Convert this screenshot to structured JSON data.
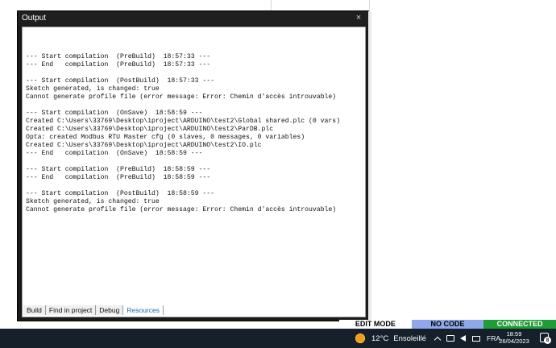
{
  "output_panel": {
    "title": "Output",
    "close_glyph": "×",
    "lines": [
      "",
      "--- Start compilation  (PreBuild)  18:57:33 ---",
      "--- End   compilation  (PreBuild)  18:57:33 ---",
      "",
      "--- Start compilation  (PostBuild)  18:57:33 ---",
      "Sketch generated, is changed: true",
      "Cannot generate profile file (error message: Error: Chemin d'accès introuvable)",
      "",
      "--- Start compilation  (OnSave)  18:58:59 ---",
      "Created C:\\Users\\33769\\Desktop\\1project\\ARDUINO\\test2\\Global shared.plc (0 vars)",
      "Created C:\\Users\\33769\\Desktop\\1project\\ARDUINO\\test2\\ParDB.plc",
      "Opta: created Modbus RTU Master cfg (0 slaves, 0 messages, 0 variables)",
      "Created C:\\Users\\33769\\Desktop\\1project\\ARDUINO\\test2\\IO.plc",
      "--- End   compilation  (OnSave)  18:58:59 ---",
      "",
      "--- Start compilation  (PreBuild)  18:58:59 ---",
      "--- End   compilation  (PreBuild)  18:58:59 ---",
      "",
      "--- Start compilation  (PostBuild)  18:58:59 ---",
      "Sketch generated, is changed: true",
      "Cannot generate profile file (error message: Error: Chemin d'accès introuvable)"
    ],
    "tabs": [
      {
        "label": "Build",
        "active": false
      },
      {
        "label": "Find in project",
        "active": false
      },
      {
        "label": "Debug",
        "active": false
      },
      {
        "label": "Resources",
        "active": true
      }
    ]
  },
  "status_modes": [
    {
      "label": "EDIT MODE",
      "bg": "#ffffff",
      "fg": "#000000"
    },
    {
      "label": "NO CODE",
      "bg": "#8ea8ea",
      "fg": "#000000"
    },
    {
      "label": "CONNECTED",
      "bg": "#1e9d36",
      "fg": "#ffffff"
    }
  ],
  "taskbar": {
    "weather_icon": "sun-icon",
    "temperature": "12°C",
    "weather_text": "Ensoleillé",
    "language": "FRA",
    "time": "18:59",
    "date": "26/04/2023",
    "notification_count": "8"
  },
  "colors": {
    "taskbar_bg": "#15202b",
    "panel_bg": "#1a1a1a",
    "active_tab": "#1d6fb0"
  }
}
